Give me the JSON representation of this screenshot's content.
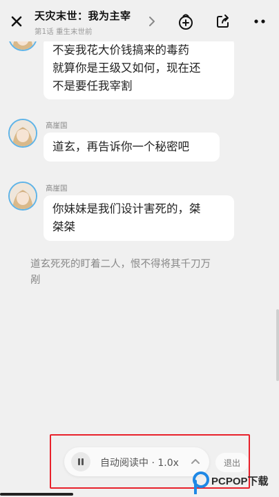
{
  "header": {
    "book_title": "天灾末世：我为主宰",
    "subtitle": "第1话 重生末世前",
    "icons": [
      "close-icon",
      "chevron-right-icon",
      "reward-icon",
      "share-icon",
      "more-icon"
    ]
  },
  "messages": [
    {
      "speaker": "",
      "lines": [
        "不妄我花大价钱搞来的毒药",
        "就算你是王级又如何，现在还",
        "不是要任我宰割"
      ]
    },
    {
      "speaker": "高崖国",
      "lines": [
        "道玄，再告诉你一个秘密吧"
      ]
    },
    {
      "speaker": "高崖国",
      "lines": [
        "你妹妹是我们设计害死的，桀",
        "桀桀"
      ]
    }
  ],
  "narration": [
    "道玄死死的盯着二人，恨不得将其千刀万",
    "剐"
  ],
  "autoread": {
    "label": "自动阅读中 · 1.0x",
    "exit_label": "退出"
  },
  "watermark": {
    "text": "PCPOP下载"
  },
  "colors": {
    "avatar_ring": "#5fb4e8",
    "highlight": "#e8202a",
    "background": "#f0f0f0",
    "bubble": "#ffffff"
  }
}
